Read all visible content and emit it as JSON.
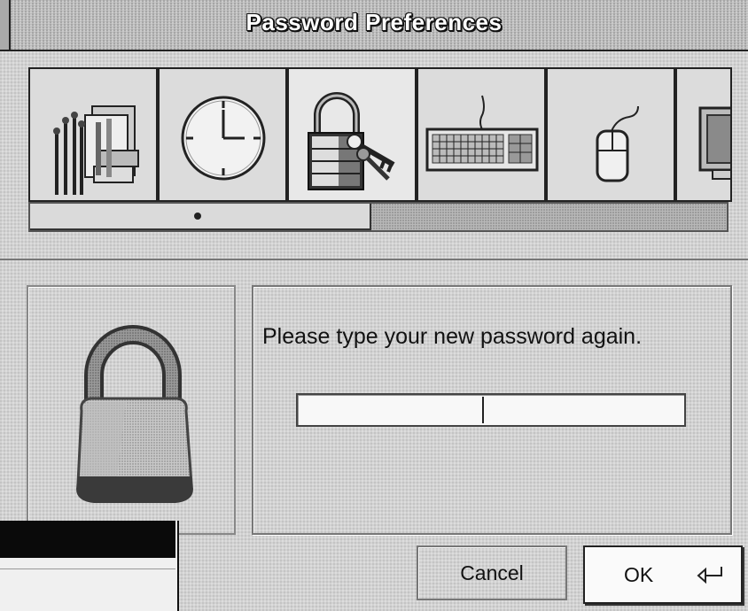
{
  "window": {
    "title": "Password Preferences"
  },
  "preference_icons": [
    {
      "name": "general-settings-icon",
      "selected": false
    },
    {
      "name": "clock-icon",
      "selected": false
    },
    {
      "name": "padlock-keys-icon",
      "selected": true
    },
    {
      "name": "keyboard-icon",
      "selected": false
    },
    {
      "name": "mouse-icon",
      "selected": false
    },
    {
      "name": "monitor-icon",
      "selected": false
    }
  ],
  "dialog": {
    "prompt": "Please type your new password again.",
    "password_value": "",
    "cancel_label": "Cancel",
    "ok_label": "OK"
  },
  "colors": {
    "background": "#d4d4d4",
    "text": "#111111",
    "title_text": "#ffffff"
  }
}
